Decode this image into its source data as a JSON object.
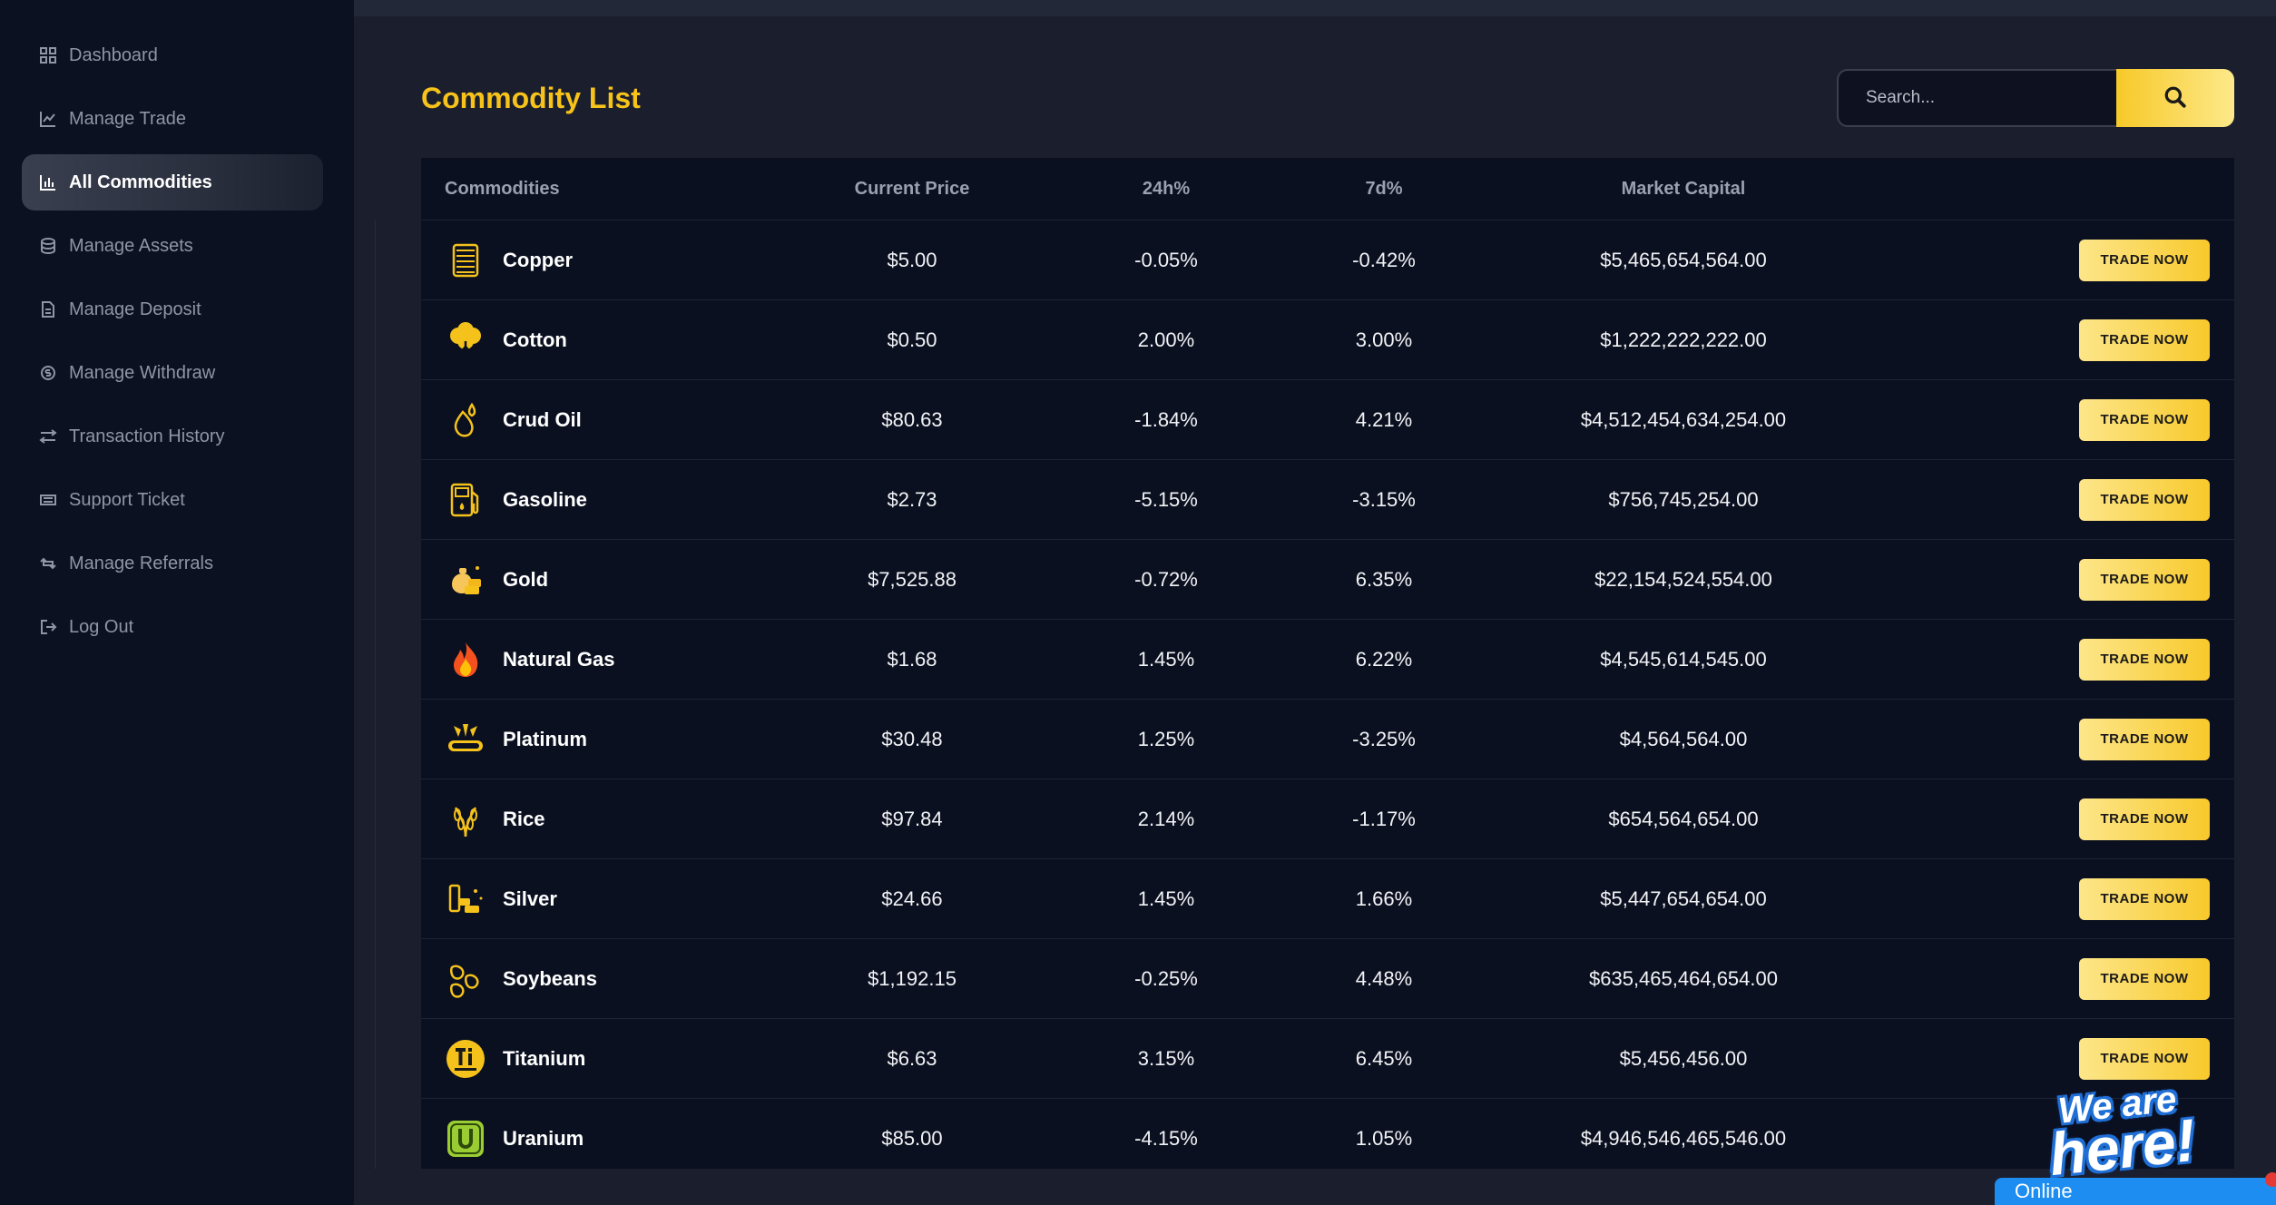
{
  "sidebar": {
    "items": [
      {
        "label": "Dashboard",
        "icon": "grid-icon"
      },
      {
        "label": "Manage Trade",
        "icon": "chart-line-icon"
      },
      {
        "label": "All Commodities",
        "icon": "chart-bar-icon",
        "active": true
      },
      {
        "label": "Manage Assets",
        "icon": "coins-icon"
      },
      {
        "label": "Manage Deposit",
        "icon": "file-invoice-icon"
      },
      {
        "label": "Manage Withdraw",
        "icon": "money-icon"
      },
      {
        "label": "Transaction History",
        "icon": "exchange-icon"
      },
      {
        "label": "Support Ticket",
        "icon": "ticket-icon"
      },
      {
        "label": "Manage Referrals",
        "icon": "retweet-icon"
      },
      {
        "label": "Log Out",
        "icon": "logout-icon"
      }
    ]
  },
  "main": {
    "title": "Commodity List",
    "search": {
      "placeholder": "Search..."
    },
    "table": {
      "headers": {
        "commodities": "Commodities",
        "price": "Current Price",
        "change24h": "24h%",
        "change7d": "7d%",
        "market_cap": "Market Capital"
      },
      "trade_label": "TRADE NOW",
      "rows": [
        {
          "name": "Copper",
          "price": "$5.00",
          "change24h": "-0.05%",
          "change7d": "-0.42%",
          "market_cap": "$5,465,654,564.00",
          "icon": "copper-icon"
        },
        {
          "name": "Cotton",
          "price": "$0.50",
          "change24h": "2.00%",
          "change7d": "3.00%",
          "market_cap": "$1,222,222,222.00",
          "icon": "cotton-icon"
        },
        {
          "name": "Crud Oil",
          "price": "$80.63",
          "change24h": "-1.84%",
          "change7d": "4.21%",
          "market_cap": "$4,512,454,634,254.00",
          "icon": "oil-drop-icon"
        },
        {
          "name": "Gasoline",
          "price": "$2.73",
          "change24h": "-5.15%",
          "change7d": "-3.15%",
          "market_cap": "$756,745,254.00",
          "icon": "gas-pump-icon"
        },
        {
          "name": "Gold",
          "price": "$7,525.88",
          "change24h": "-0.72%",
          "change7d": "6.35%",
          "market_cap": "$22,154,524,554.00",
          "icon": "gold-icon"
        },
        {
          "name": "Natural Gas",
          "price": "$1.68",
          "change24h": "1.45%",
          "change7d": "6.22%",
          "market_cap": "$4,545,614,545.00",
          "icon": "flame-icon"
        },
        {
          "name": "Platinum",
          "price": "$30.48",
          "change24h": "1.25%",
          "change7d": "-3.25%",
          "market_cap": "$4,564,564.00",
          "icon": "platinum-icon"
        },
        {
          "name": "Rice",
          "price": "$97.84",
          "change24h": "2.14%",
          "change7d": "-1.17%",
          "market_cap": "$654,564,654.00",
          "icon": "rice-icon"
        },
        {
          "name": "Silver",
          "price": "$24.66",
          "change24h": "1.45%",
          "change7d": "1.66%",
          "market_cap": "$5,447,654,654.00",
          "icon": "silver-icon"
        },
        {
          "name": "Soybeans",
          "price": "$1,192.15",
          "change24h": "-0.25%",
          "change7d": "4.48%",
          "market_cap": "$635,465,464,654.00",
          "icon": "soybeans-icon"
        },
        {
          "name": "Titanium",
          "price": "$6.63",
          "change24h": "3.15%",
          "change7d": "6.45%",
          "market_cap": "$5,456,456.00",
          "icon": "titanium-icon"
        },
        {
          "name": "Uranium",
          "price": "$85.00",
          "change24h": "-4.15%",
          "change7d": "1.05%",
          "market_cap": "$4,946,546,465,546.00",
          "icon": "uranium-icon"
        }
      ]
    }
  },
  "chat": {
    "badge_line1": "We are",
    "badge_line2": "here!",
    "status": "Online"
  },
  "colors": {
    "accent": "#f7c21a",
    "sidebar_bg": "#0c1122",
    "page_bg": "#1b1f2d",
    "table_bg": "#0b1020",
    "chat_blue": "#1d8df2"
  }
}
